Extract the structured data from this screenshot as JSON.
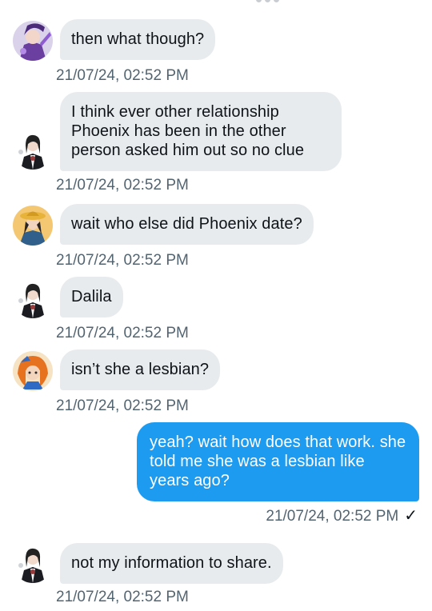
{
  "colors": {
    "incoming_bubble": "#e8ebee",
    "outgoing_bubble": "#1d9bf0",
    "timestamp": "#536471",
    "text": "#0f1419"
  },
  "messages": [
    {
      "avatar": "purple-character-avatar",
      "text": "then what though?",
      "time": "21/07/24, 02:52 PM"
    },
    {
      "avatar": "dark-haired-character-avatar",
      "text": "I think ever other relationship\nPhoenix has been in the other\nperson asked him out so no clue",
      "time": "21/07/24, 02:52 PM"
    },
    {
      "avatar": "yellow-hat-character-avatar",
      "text": "wait who else did Phoenix date?",
      "time": "21/07/24, 02:52 PM"
    },
    {
      "avatar": "dark-haired-character-avatar",
      "text": "Dalila",
      "time": "21/07/24, 02:52 PM"
    },
    {
      "avatar": "orange-haired-character-avatar",
      "text": "isn’t she a lesbian?",
      "time": "21/07/24, 02:52 PM"
    },
    {
      "avatar": "",
      "text": "yeah? wait how does that work. she\ntold me she was a lesbian like\nyears ago?",
      "time": "21/07/24, 02:52 PM",
      "check": "✓"
    },
    {
      "avatar": "dark-haired-character-avatar",
      "text": "not my information to share.",
      "time": "21/07/24, 02:52 PM"
    }
  ]
}
